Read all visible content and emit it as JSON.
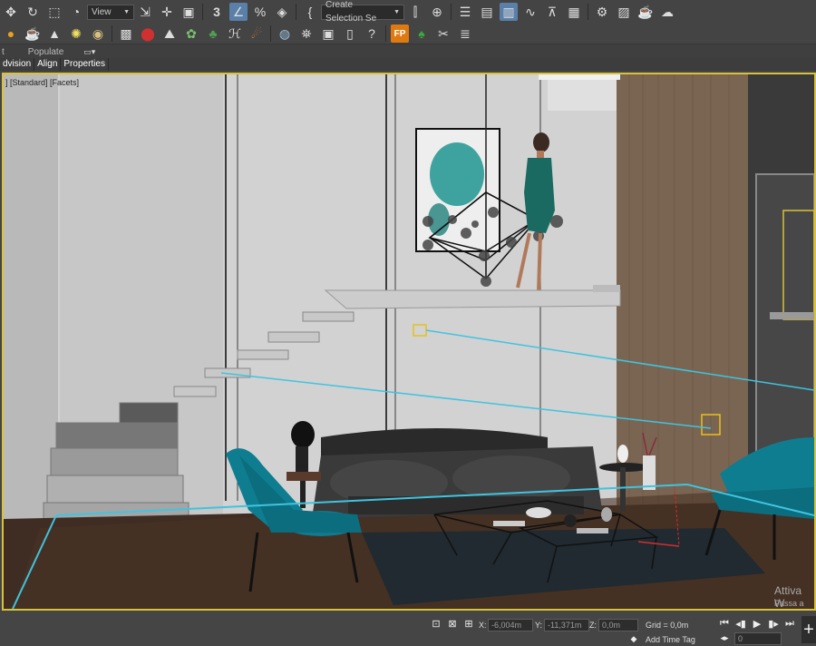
{
  "toolbar": {
    "view_dropdown": "View",
    "selection_set": "Create Selection Se"
  },
  "toolbar2": {
    "fp_label": "FP"
  },
  "ribbon": {
    "items": [
      "t",
      "Populate"
    ]
  },
  "tabs": [
    "dvision",
    "Align",
    "Properties"
  ],
  "viewport": {
    "label": "] [Standard] [Facets]",
    "watermark_line1": "Attiva W",
    "watermark_line2": "Passa a Im"
  },
  "status": {
    "x_label": "X:",
    "x_value": "-6,004m",
    "y_label": "Y:",
    "y_value": "-11,371m",
    "z_label": "Z:",
    "z_value": "0,0m",
    "grid": "Grid = 0,0m",
    "add_time_tag": "Add Time Tag",
    "frame_value": "0"
  },
  "colors": {
    "accent": "#5a7fa8",
    "viewport_border": "#d8c23a",
    "light_gizmo": "#3fc4e0",
    "teal_chair": "#0f7d90"
  },
  "icons": {
    "toolbar1": [
      "move-icon",
      "undo-icon",
      "select-region-icon",
      "link-icon",
      "view-dropdown",
      "select-object-icon",
      "move-gizmo-icon",
      "scale-icon",
      "snap3-icon",
      "angle-snap-icon",
      "percent-snap-icon",
      "spinner-snap-icon",
      "named-selection-icon",
      "selection-set-dropdown",
      "mirror-icon",
      "align-icon",
      "layer-manager-icon",
      "scene-explorer-icon",
      "ribbon-toggle-icon",
      "curve-editor-icon",
      "schematic-view-icon",
      "material-editor-icon",
      "render-setup-icon",
      "rendered-frame-icon",
      "render-icon",
      "render-cloud-icon"
    ],
    "toolbar2": [
      "sphere-icon",
      "teapot-icon",
      "cone-icon",
      "sun-icon",
      "light-icon",
      "grid-icon",
      "spheres-icon",
      "scatter-icon",
      "plant-icon",
      "tree-icon",
      "hair-icon",
      "cloth-icon",
      "render-sphere-icon",
      "sun-settings-icon",
      "frame-icon",
      "script-icon",
      "help-icon",
      "fp-icon",
      "forest-icon",
      "tools-icon",
      "list-icon"
    ]
  }
}
